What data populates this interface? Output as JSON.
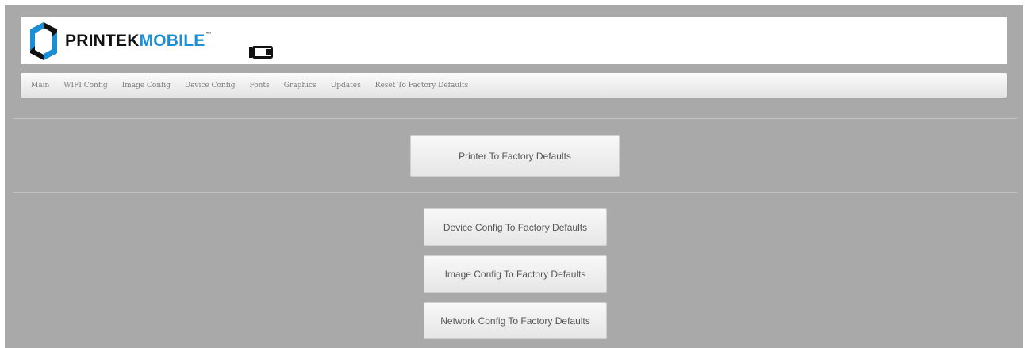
{
  "header": {
    "logo": {
      "text_part1": "PRINTEK",
      "text_part2": "MOBILE",
      "trademark": "™"
    },
    "battery_icon": "battery-icon"
  },
  "nav": {
    "items": [
      {
        "label": "Main"
      },
      {
        "label": "WIFI Config"
      },
      {
        "label": "Image Config"
      },
      {
        "label": "Device Config"
      },
      {
        "label": "Fonts"
      },
      {
        "label": "Graphics"
      },
      {
        "label": "Updates"
      },
      {
        "label": "Reset To Factory Defaults"
      }
    ]
  },
  "actions": {
    "printer_defaults": "Printer To Factory Defaults",
    "device_config_defaults": "Device Config To Factory Defaults",
    "image_config_defaults": "Image Config To Factory Defaults",
    "network_config_defaults": "Network Config To Factory Defaults"
  },
  "colors": {
    "background": "#a9a9a9",
    "brand_dark": "#111111",
    "brand_blue": "#1b8fd6"
  }
}
